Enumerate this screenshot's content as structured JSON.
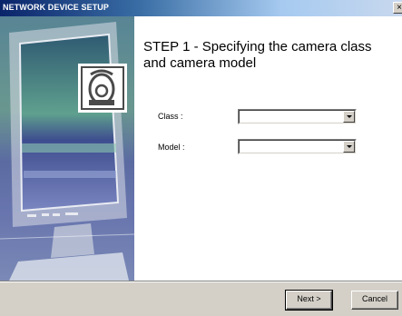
{
  "window": {
    "title": "NETWORK DEVICE SETUP",
    "close_label": "×"
  },
  "step": {
    "title": "STEP 1 -  Specifying the camera class\nand camera model"
  },
  "form": {
    "class_label": "Class :",
    "class_value": "",
    "model_label": "Model :",
    "model_value": ""
  },
  "buttons": {
    "next_label": "Next >",
    "cancel_label": "Cancel"
  },
  "icons": {
    "side_illustration": "monitor-camera-illustration",
    "camera": "camera-icon"
  }
}
